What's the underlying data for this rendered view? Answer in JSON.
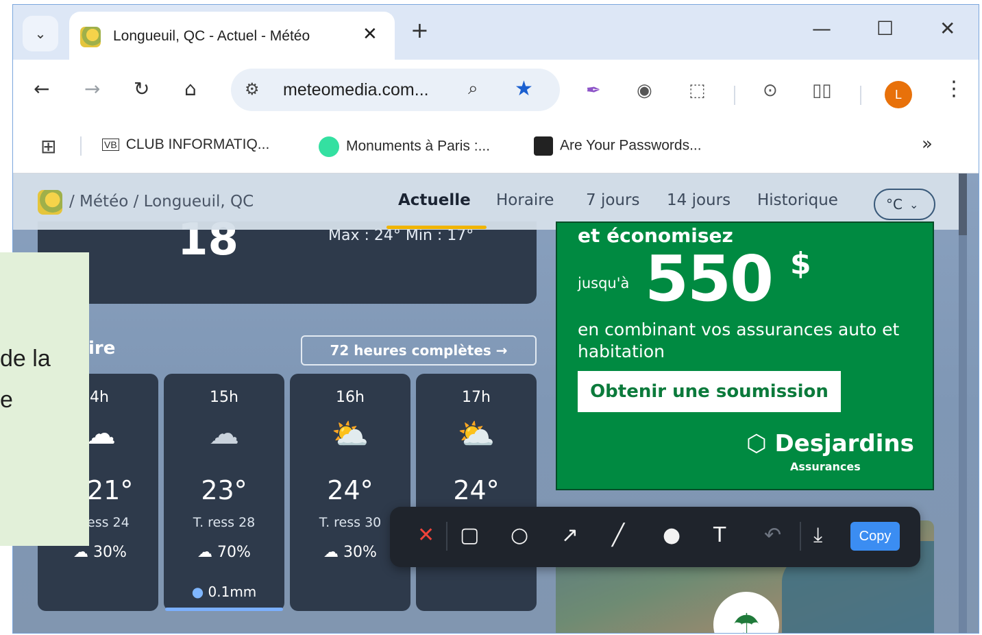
{
  "browser": {
    "tab": {
      "title": "Longueuil, QC - Actuel - Météo"
    },
    "toolbar": {
      "url": "meteomedia.com...",
      "profile_initial": "L"
    },
    "bookmarks": [
      {
        "label": "CLUB INFORMATIQ...",
        "icon": "vbdl-logo-icon"
      },
      {
        "label": "Monuments à Paris :...",
        "icon": "tripadvisor-icon"
      },
      {
        "label": "Are Your Passwords...",
        "icon": "bookmark-site-icon"
      }
    ],
    "overflow": "»"
  },
  "site": {
    "breadcrumb": "/ Météo / Longueuil, QC",
    "nav": [
      "Actuelle",
      "Horaire",
      "7 jours",
      "14 jours",
      "Historique"
    ],
    "active_nav": "Actuelle",
    "unit": "°C",
    "current": {
      "temp": "18",
      "maxmin": "Max : 24°  Min : 17°"
    },
    "section_title": "ire",
    "hours_button": "72 heures complètes →",
    "hourly": [
      {
        "hour": "4h",
        "temp": "21°",
        "feel": "ess 24",
        "pop": "30%",
        "mm": ""
      },
      {
        "hour": "15h",
        "temp": "23°",
        "feel": "T. ress 28",
        "pop": "70%",
        "mm": "0.1mm"
      },
      {
        "hour": "16h",
        "temp": "24°",
        "feel": "T. ress 30",
        "pop": "30%",
        "mm": ""
      },
      {
        "hour": "17h",
        "temp": "24°",
        "feel": "",
        "pop": "",
        "mm": ""
      }
    ],
    "ad": {
      "headline": "et économisez",
      "upto": "jusqu'à",
      "amount": "550",
      "currency": "$",
      "combo": "en combinant vos assurances auto et habitation",
      "cta": "Obtenir une soumission",
      "brand": "Desjardins",
      "brand_sub": "Assurances"
    }
  },
  "snip_toolbar": {
    "copy": "Copy"
  },
  "overlay_note": {
    "line1": "de la",
    "line2": "e"
  },
  "colors": {
    "accent": "#1a5fd0",
    "ad_green": "#008a41",
    "snip_blue": "#3b8df2",
    "close_red": "#f0433a"
  }
}
